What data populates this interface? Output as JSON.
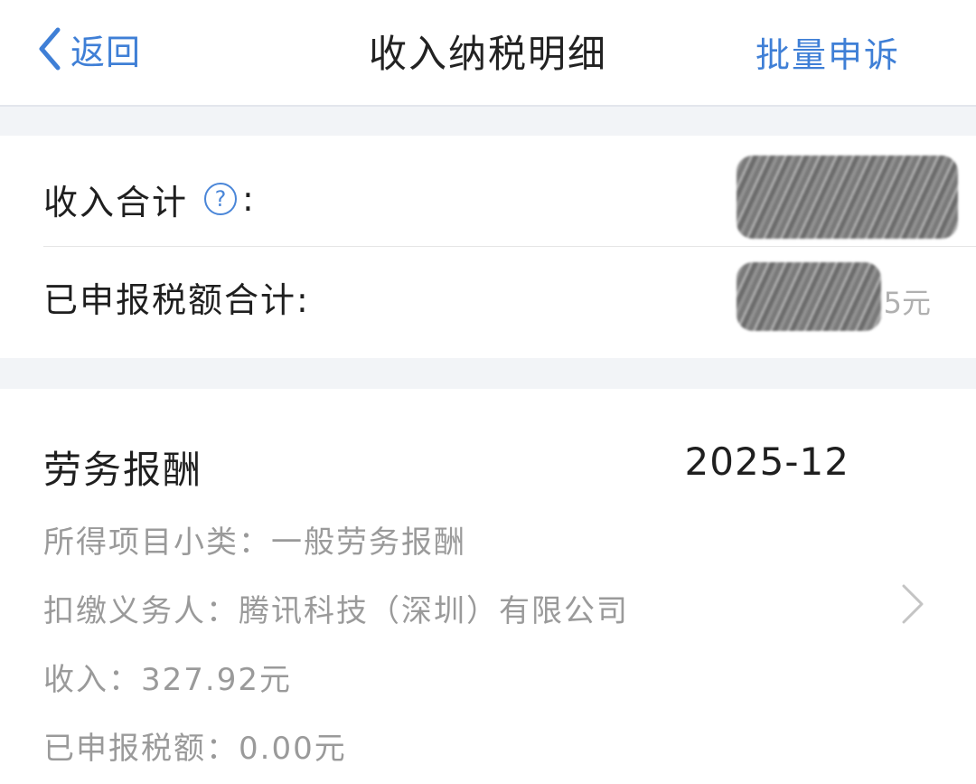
{
  "nav": {
    "back_label": "返回",
    "title": "收入纳税明细",
    "right_action": "批量申诉"
  },
  "summary": {
    "total_income_label": "收入合计",
    "colon": ":",
    "total_income_value": "",
    "reported_tax_label": "已申报税额合计:",
    "reported_tax_value_visible_suffix": "5元"
  },
  "record": {
    "income_type": "劳务报酬",
    "period": "2025-12",
    "subcategory": "所得项目小类：一般劳务报酬",
    "withholding_agent": "扣缴义务人：腾讯科技（深圳）有限公司",
    "income": "收入：327.92元",
    "reported_tax": "已申报税额：0.00元"
  },
  "icons": {
    "back": "chevron-left-icon",
    "help": "question-circle-icon",
    "detail": "chevron-right-icon"
  },
  "colors": {
    "accent": "#3f7fd6",
    "secondary_text": "#9a9a9a",
    "band": "#f2f4f7"
  }
}
